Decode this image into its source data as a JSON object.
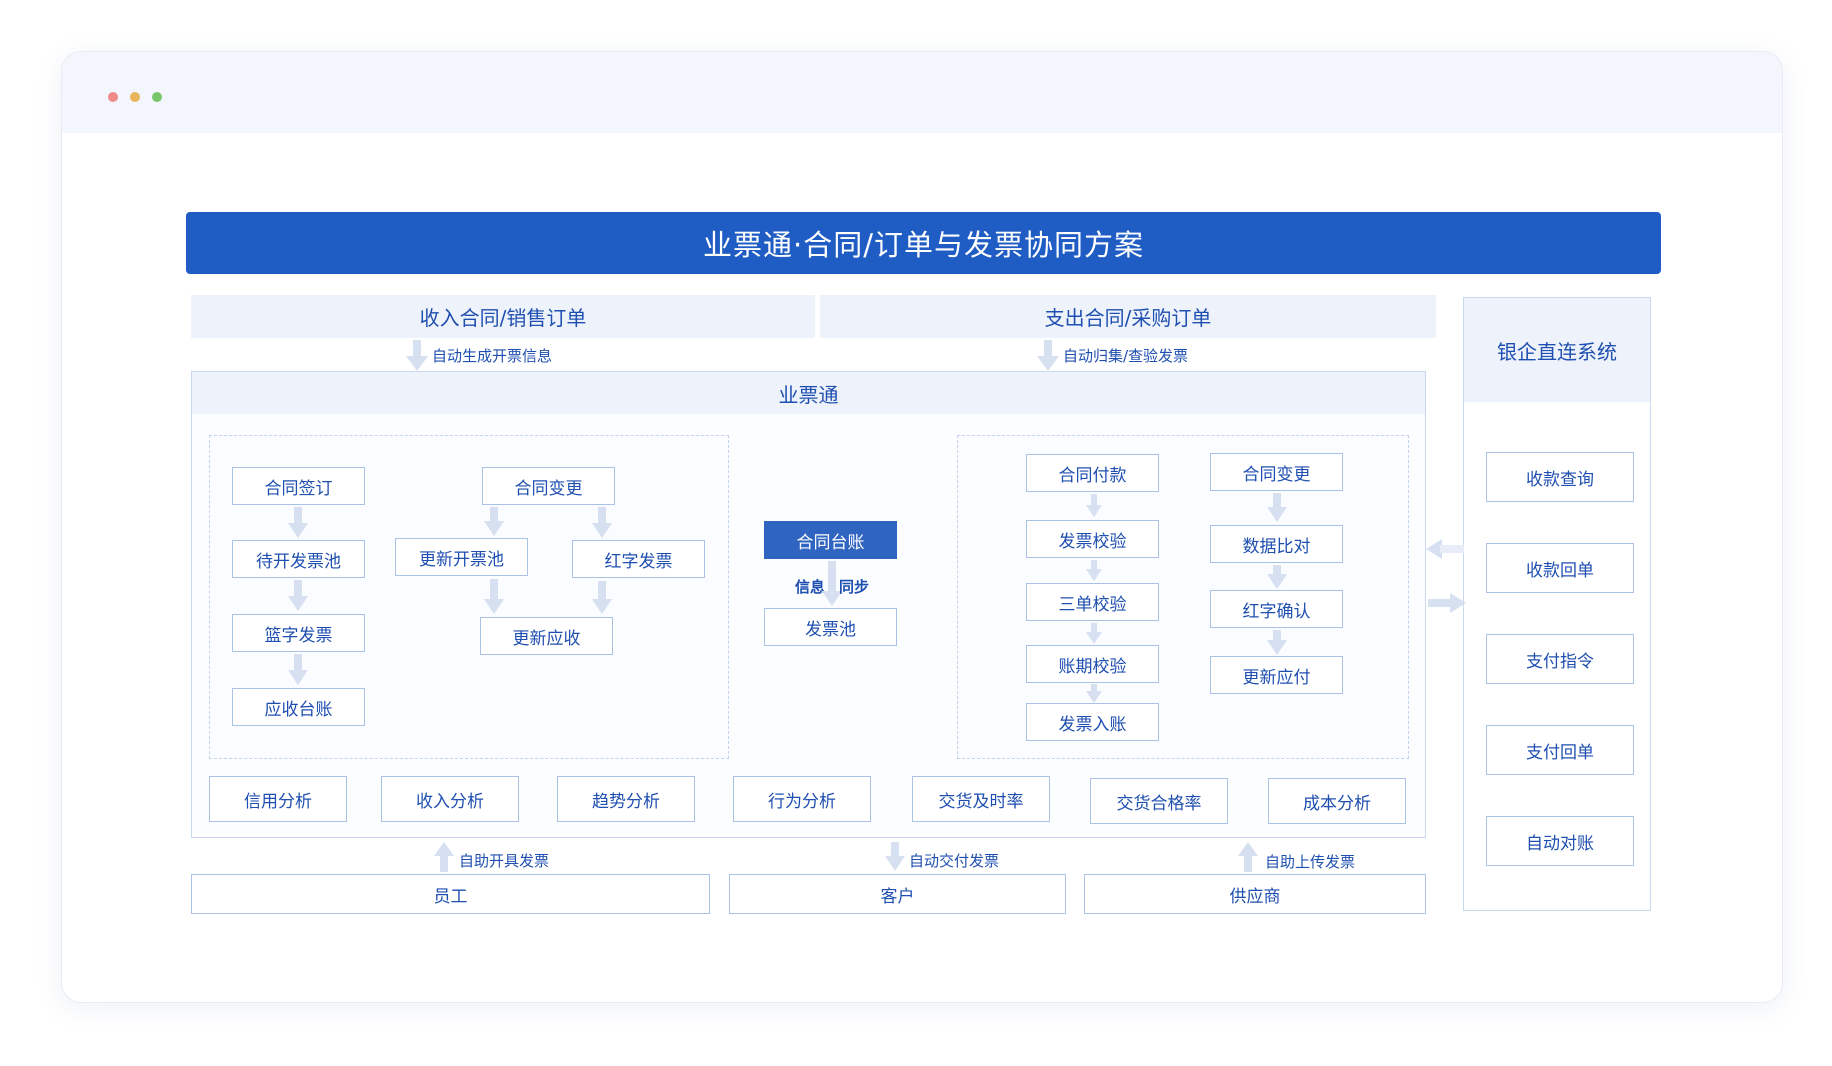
{
  "title": "业票通·合同/订单与发票协同方案",
  "sections": {
    "income": "收入合同/销售订单",
    "expense": "支出合同/采购订单",
    "bank": "银企直连系统",
    "platform": "业票通"
  },
  "flows": {
    "income_to_platform": "自动生成开票信息",
    "expense_to_platform": "自动归集/查验发票",
    "employee": "自助开具发票",
    "customer": "自动交付发票",
    "supplier": "自助上传发票"
  },
  "left_panel": {
    "sign": "合同签订",
    "pending_pool": "待开发票池",
    "blue_invoice": "篮字发票",
    "receivable_ledger": "应收台账",
    "change": "合同变更",
    "update_pool": "更新开票池",
    "red_invoice": "红字发票",
    "update_receivable": "更新应收"
  },
  "center": {
    "ledger": "合同台账",
    "info": "信息",
    "sync": "同步",
    "invoice_pool": "发票池"
  },
  "right_panel": {
    "payment": "合同付款",
    "invoice_verify": "发票校验",
    "three_way": "三单校验",
    "period_verify": "账期校验",
    "invoice_posting": "发票入账",
    "change": "合同变更",
    "data_compare": "数据比对",
    "red_confirm": "红字确认",
    "update_payable": "更新应付"
  },
  "analytics": [
    "信用分析",
    "收入分析",
    "趋势分析",
    "行为分析",
    "交货及时率",
    "交货合格率",
    "成本分析"
  ],
  "parties": {
    "employee": "员工",
    "customer": "客户",
    "supplier": "供应商"
  },
  "bank_items": [
    "收款查询",
    "收款回单",
    "支付指令",
    "支付回单",
    "自动对账"
  ],
  "colors": {
    "primary": "#1f5cc4",
    "text": "#1f4fb0",
    "section_bg": "#eef3fb",
    "border": "#a9c2e6"
  }
}
